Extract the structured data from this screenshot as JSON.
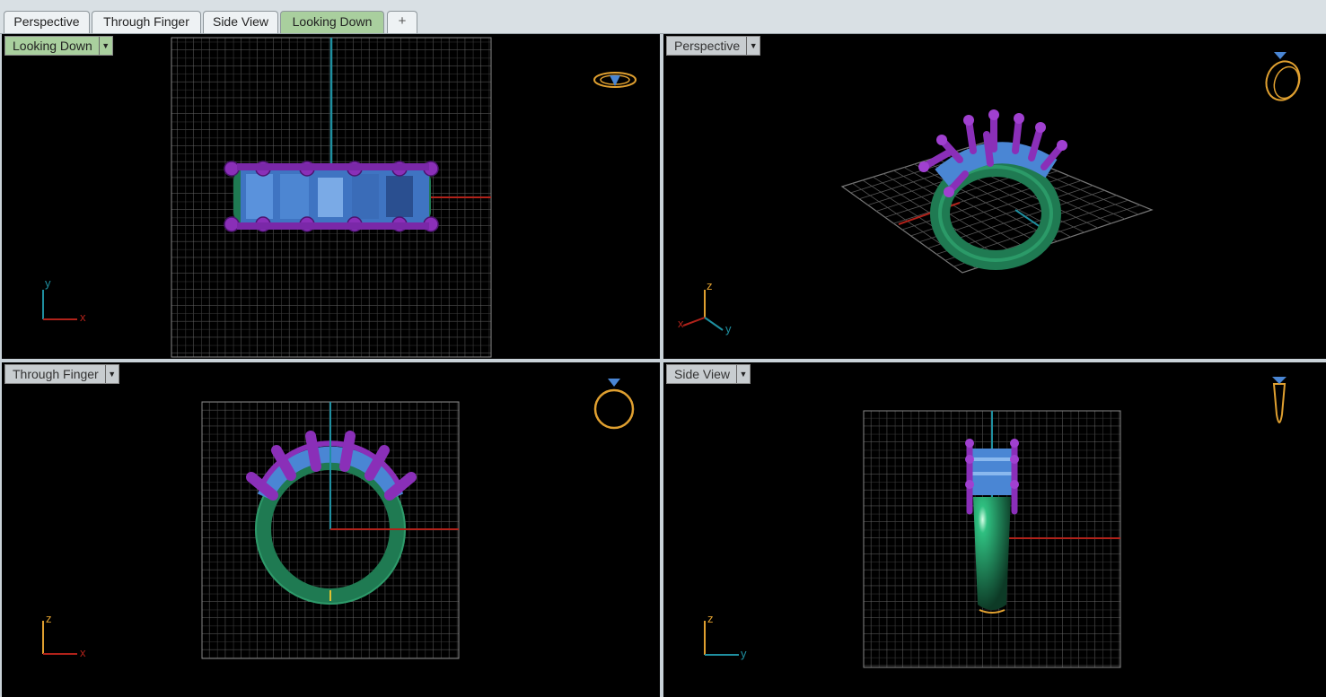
{
  "tabs": {
    "perspective": "Perspective",
    "through_finger": "Through Finger",
    "side_view": "Side View",
    "looking_down": "Looking Down",
    "add": "+"
  },
  "viewports": {
    "looking_down": {
      "label": "Looking Down",
      "axis1": "y",
      "axis2": "x"
    },
    "perspective": {
      "label": "Perspective",
      "axis_z": "z",
      "axis_x": "x",
      "axis_y": "y"
    },
    "through_finger": {
      "label": "Through Finger",
      "axis1": "z",
      "axis2": "x"
    },
    "side_view": {
      "label": "Side View",
      "axis1": "z",
      "axis2": "y"
    }
  },
  "colors": {
    "band": "#1f7a52",
    "stone": "#4a86d4",
    "prong": "#8a2fb8",
    "active_tab": "#a9cf9e",
    "x_axis": "#b0221a",
    "y_axis": "#1f8fa0",
    "gumball": "#e0a030"
  }
}
